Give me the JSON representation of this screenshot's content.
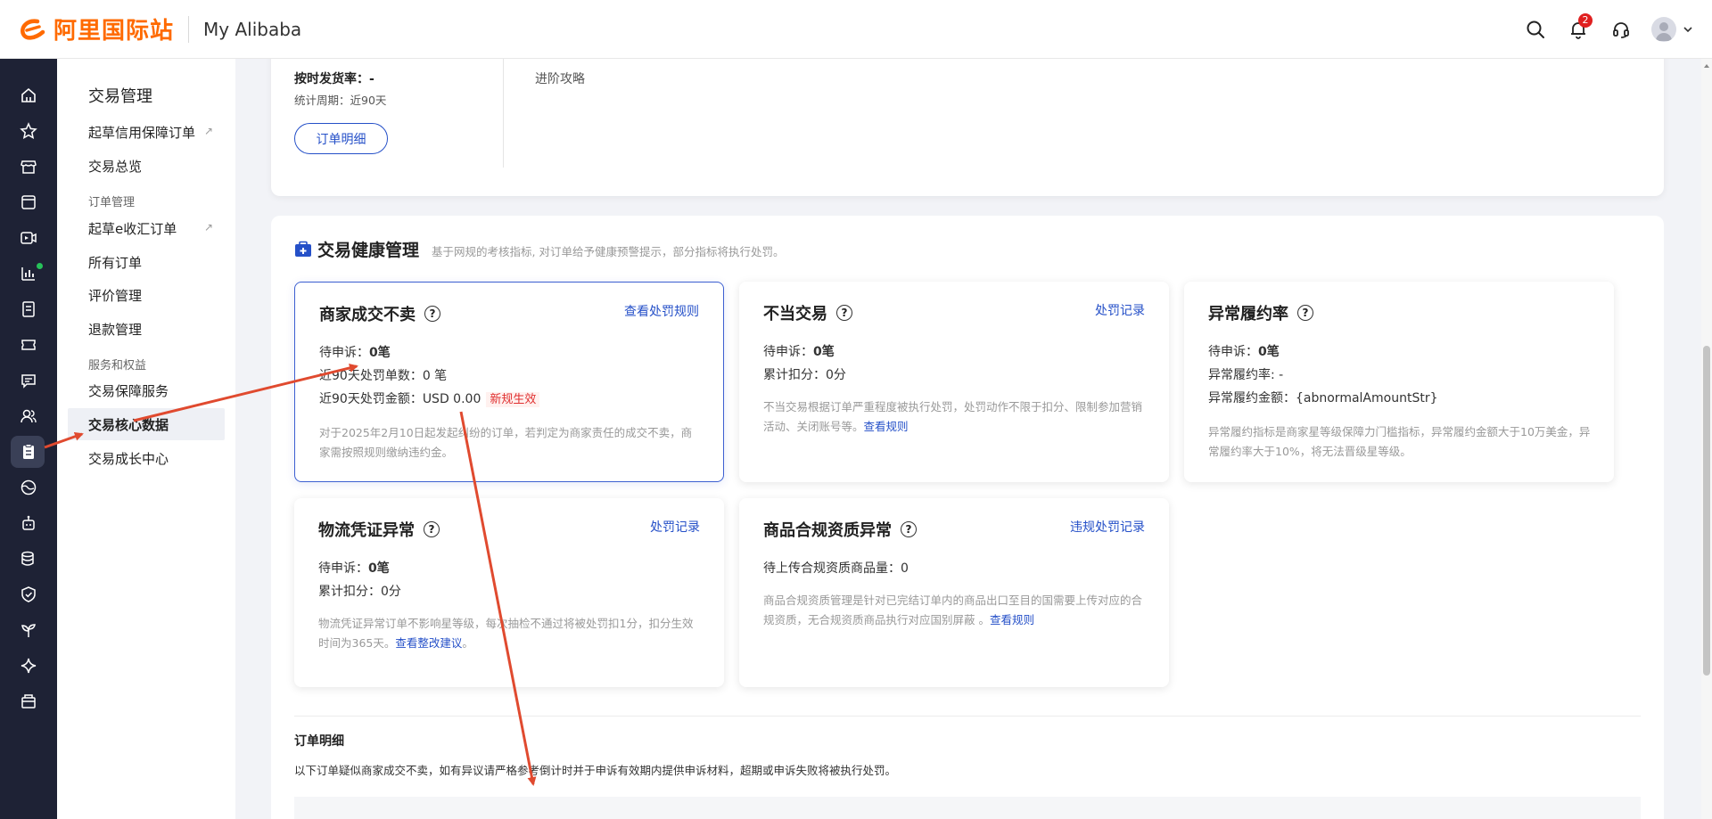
{
  "header": {
    "logo_text": "阿里国际站",
    "brand": "My Alibaba",
    "notification_count": "2"
  },
  "rail": {
    "icons": [
      "home-icon",
      "star-icon",
      "store-icon",
      "browser-icon",
      "video-icon",
      "chart-icon",
      "document-icon",
      "ticket-icon",
      "message-icon",
      "people-icon",
      "clipboard-icon",
      "globe-icon",
      "ai-bot-icon",
      "database-icon",
      "shield-icon",
      "plant-icon",
      "sparkle-icon",
      "box-icon"
    ]
  },
  "menu": {
    "title": "交易管理",
    "items": [
      {
        "label": "起草信用保障订单",
        "ext": "↗"
      },
      {
        "label": "交易总览"
      },
      {
        "group": "订单管理"
      },
      {
        "label": "起草e收汇订单",
        "ext": "↗"
      },
      {
        "label": "所有订单"
      },
      {
        "label": "评价管理"
      },
      {
        "label": "退款管理"
      },
      {
        "group": "服务和权益"
      },
      {
        "label": "交易保障服务"
      },
      {
        "label": "交易核心数据",
        "active": true
      },
      {
        "label": "交易成长中心"
      }
    ]
  },
  "top_card": {
    "ontime_label": "按时发货率：",
    "ontime_value": "-",
    "period": "统计周期：近90天",
    "order_detail_btn": "订单明细",
    "advanced_tips": "进阶攻略"
  },
  "health": {
    "title": "交易健康管理",
    "subtitle": "基于网规的考核指标, 对订单给予健康预警提示，部分指标将执行处罚。",
    "cards": {
      "seller_refuse": {
        "title": "商家成交不卖",
        "link": "查看处罚规则",
        "pending_label": "待申诉：",
        "pending_value": "0笔",
        "penalty_count": "近90天处罚单数：0 笔",
        "penalty_amount": "近90天处罚金额：USD 0.00",
        "new_tag": "新规生效",
        "desc": "对于2025年2月10日起发起纠纷的订单，若判定为商家责任的成交不卖，商家需按照规则缴纳违约金。"
      },
      "improper_trade": {
        "title": "不当交易",
        "link": "处罚记录",
        "pending_label": "待申诉：",
        "pending_value": "0笔",
        "deduct": "累计扣分：0分",
        "desc": "不当交易根据订单严重程度被执行处罚，处罚动作不限于扣分、限制参加营销活动、关闭账号等。",
        "desc_link": "查看规则"
      },
      "abnormal_fulfill": {
        "title": "异常履约率",
        "pending_label": "待申诉：",
        "pending_value": "0笔",
        "rate": "异常履约率: -",
        "amount": "异常履约金额：{abnormalAmountStr}",
        "desc": "异常履约指标是商家星等级保障力门槛指标，异常履约金额大于10万美金，异常履约率大于10%，将无法晋级星等级。"
      },
      "logistics": {
        "title": "物流凭证异常",
        "link": "处罚记录",
        "pending_label": "待申诉：",
        "pending_value": "0笔",
        "deduct": "累计扣分：0分",
        "desc": "物流凭证异常订单不影响星等级，每次抽检不通过将被处罚扣1分，扣分生效时间为365天。",
        "desc_link": "查看整改建议",
        "desc_tail": "。"
      },
      "compliance": {
        "title": "商品合规资质异常",
        "link": "违规处罚记录",
        "pending": "待上传合规资质商品量：0",
        "desc": "商品合规资质管理是针对已完结订单内的商品出口至目的国需要上传对应的合规资质，无合规资质商品执行对应国别屏蔽 。",
        "desc_link": "查看规则"
      }
    },
    "order_detail": {
      "title": "订单明细",
      "desc": "以下订单疑似商家成交不卖，如有异议请严格参考倒计时并于申诉有效期内提供申诉材料，超期或申诉失败将被执行处罚。"
    }
  },
  "colors": {
    "accent": "#ff6a00",
    "link": "#2550c8",
    "annotation_arrow": "#e04a2f",
    "rail_bg": "#1e2235"
  }
}
